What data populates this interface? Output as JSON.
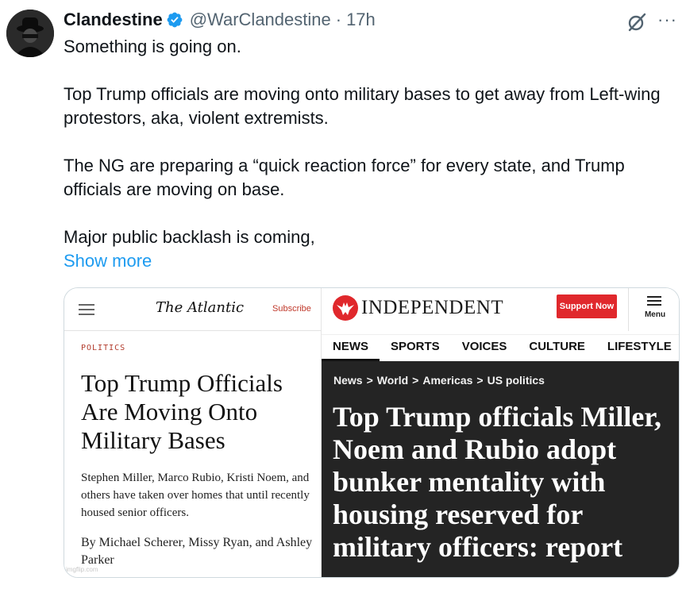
{
  "tweet": {
    "author": {
      "display_name": "Clandestine",
      "handle": "@WarClandestine",
      "separator": "·",
      "time": "17h",
      "verified": true,
      "avatar_icon": "masked-figure-avatar"
    },
    "paragraphs": [
      "Something is going on.",
      "Top Trump officials are moving onto military bases to get away from Left-wing protestors, aka, violent extremists.",
      "The NG are preparing a “quick reaction force” for every state, and Trump officials are moving on base.",
      "Major public backlash is coming,"
    ],
    "show_more": "Show more",
    "icons": {
      "verified": "verified-badge-icon",
      "grok": "grok-icon",
      "more": "more-options-icon"
    },
    "more_glyph": "···"
  },
  "media": {
    "atlantic": {
      "logo": "The Atlantic",
      "subscribe": "Subscribe",
      "section": "POLITICS",
      "headline": "Top Trump Officials Are Moving Onto Military Bases",
      "dek": "Stephen Miller, Marco Rubio, Kristi Noem, and others have taken over homes that until recently housed senior officers.",
      "byline": "By Michael Scherer, Missy Ryan, and Ashley Parker",
      "watermark": "imgflip.com"
    },
    "independent": {
      "logo": "INDEPENDENT",
      "support_button": "Support Now",
      "menu_label": "Menu",
      "tabs": [
        "NEWS",
        "SPORTS",
        "VOICES",
        "CULTURE",
        "LIFESTYLE"
      ],
      "active_tab": "NEWS",
      "breadcrumbs": [
        "News",
        "World",
        "Americas",
        "US politics"
      ],
      "breadcrumb_separator": ">",
      "headline": "Top Trump officials Miller, Noem and Rubio adopt bunker mentality with housing reserved for military officers: report"
    }
  },
  "colors": {
    "link": "#1d9bf0",
    "verified": "#1d9bf0",
    "secondary_text": "#536471",
    "independent_red": "#e0282c",
    "atlantic_red": "#b23b2c",
    "hero_bg": "#242424"
  }
}
